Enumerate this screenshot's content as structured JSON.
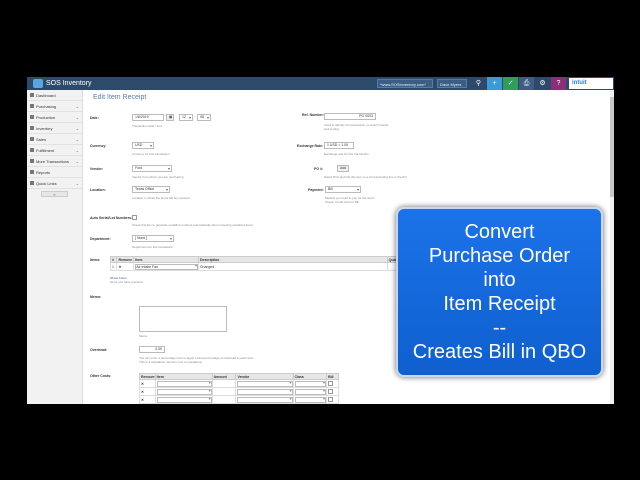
{
  "app": {
    "title": "SOS Inventory"
  },
  "topbar": {
    "company_select": "*www.SOSInventory.com*",
    "user_select": "Dave Myers",
    "buttons": [
      "search-icon",
      "plus-icon",
      "check-icon",
      "print-icon",
      "gear-icon",
      "help-icon"
    ],
    "intuit_label": "intuit"
  },
  "sidebar": {
    "items": [
      {
        "label": "Dashboard",
        "chevron": false
      },
      {
        "label": "Purchasing",
        "chevron": true
      },
      {
        "label": "Production",
        "chevron": true
      },
      {
        "label": "Inventory",
        "chevron": true
      },
      {
        "label": "Sales",
        "chevron": true
      },
      {
        "label": "Fulfillment",
        "chevron": true
      },
      {
        "label": "More Transactions",
        "chevron": true
      },
      {
        "label": "Reports",
        "chevron": false
      },
      {
        "label": "Quick Links",
        "chevron": true
      }
    ],
    "collapse_label": "«"
  },
  "page": {
    "title": "Edit Item Receipt"
  },
  "form": {
    "date": {
      "label": "Date:",
      "value": "1/8/2019",
      "hour": "12",
      "minute": "08",
      "hint": "Transaction date / time"
    },
    "ref": {
      "label": "Ref. Number:",
      "value": "PO 0003",
      "hint": "Used to identify the transaction or search results and sorting"
    },
    "currency": {
      "label": "Currency:",
      "value": "USD",
      "hint": "Currency for this transaction"
    },
    "exchange": {
      "label": "Exchange Rate:",
      "value": "1 USD = 1.00",
      "hint": "Exchange rate for this transaction"
    },
    "vendor": {
      "label": "Vendor:",
      "value": "Ford",
      "hint": "Vendor from whom you are purchasing"
    },
    "po": {
      "label": "PO #:",
      "button": "Add",
      "hint": "Select POs and link this item to a corresponding line in the PO"
    },
    "location": {
      "label": "Location:",
      "value": "Texas Office",
      "hint": "Location in which the items will be received"
    },
    "payment": {
      "label": "Payment:",
      "value": "Bill",
      "hint": "Method you used to pay for the items",
      "hint2": "Check, Credit Card or Bill"
    },
    "auto_serial": {
      "label": "Auto Serial/Lot Numbers:",
      "hint": "Check this box to generate serial/lot numbers automatically when receiving serialized items"
    },
    "department": {
      "label": "Department:",
      "value": "[ None ]",
      "hint": "Department for this transaction"
    },
    "items": {
      "label": "Items:",
      "headers": [
        "#",
        "Remove",
        "Item",
        "Description",
        "Quantity"
      ],
      "rows": [
        {
          "num": "1",
          "remove": "✕",
          "item": "Air Intake Fan",
          "description": "Changed",
          "quantity": "1"
        }
      ],
      "hint": "Items you have received",
      "show_lines": "Show Lines"
    },
    "memo": {
      "label": "Memo:",
      "hint": "Memo"
    },
    "overhead": {
      "label": "Overhead:",
      "value": "0.00",
      "hint": "You can enter a percentage here to apply a fixed percentage of overhead to each item.",
      "hint2": "This is a calculation used for cost computations"
    },
    "other_costs": {
      "label": "Other Costs:",
      "headers": [
        "Remove",
        "Item",
        "Amount",
        "Vendor",
        "Class",
        "Bill"
      ],
      "rows": [
        {
          "remove": "✕"
        },
        {
          "remove": "✕"
        },
        {
          "remove": "✕"
        },
        {
          "remove": "✕"
        }
      ]
    }
  },
  "callout": {
    "lines": [
      "Convert",
      "Purchase Order",
      "into",
      "Item Receipt",
      "--",
      "Creates Bill in QBO"
    ],
    "bg": "#1b73e8"
  }
}
